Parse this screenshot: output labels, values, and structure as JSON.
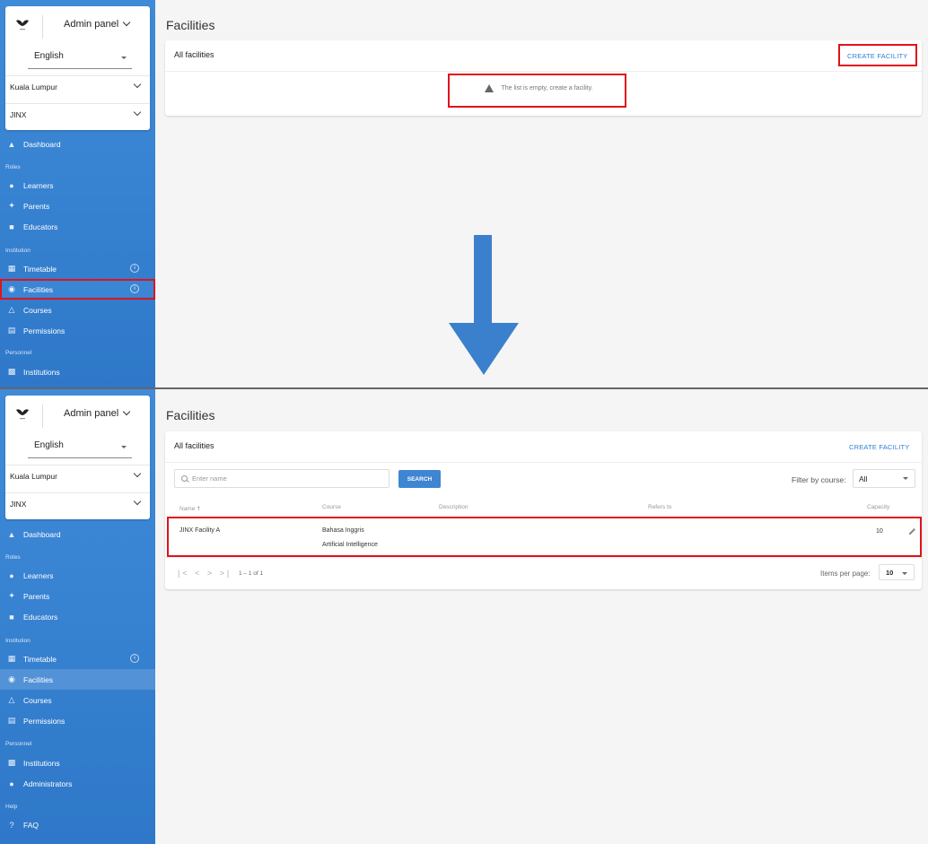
{
  "brand": {
    "logo_icon": "bird-logo-icon",
    "logo_text": "JINX"
  },
  "sidebar": {
    "panel_label": "Admin panel",
    "language": "English",
    "location": "Kuala Lumpur",
    "institution": "JINX",
    "top_nav": {
      "dashboard": "Dashboard",
      "roles": "Roles",
      "learners": "Learners",
      "parents": "Parents",
      "educators": "Educators",
      "institution": "Institution",
      "timetable": "Timetable",
      "facilities": "Facilities",
      "courses": "Courses",
      "permissions": "Permissions",
      "personnel": "Personnel",
      "institutions": "Institutions"
    },
    "bottom_nav_extra": {
      "administrators": "Administrators",
      "help": "Help",
      "faq": "FAQ"
    },
    "info_glyph": "i"
  },
  "before": {
    "heading": "Facilities",
    "card_title": "All facilities",
    "create_label": "CREATE FACILITY",
    "empty_message": "The list is empty, create a facility."
  },
  "after": {
    "heading": "Facilities",
    "card_title": "All facilities",
    "create_label": "CREATE FACILITY",
    "search_placeholder": "Enter name",
    "search_button": "SEARCH",
    "filter_label": "Filter by course:",
    "filter_value": "All",
    "columns": {
      "name": "Name",
      "sort_arrow": "↑",
      "course": "Course",
      "description": "Description",
      "refers_to": "Refers to",
      "capacity": "Capacity"
    },
    "rows": [
      {
        "name": "JINX Facility A",
        "course_1": "Bahasa Inggris",
        "course_2": "Artificial Intelligence",
        "description": "",
        "refers_to": "",
        "capacity": "10"
      }
    ],
    "pagination": {
      "controls": "|< < > >|",
      "range": "1 – 1 of 1",
      "items_per_page_label": "Items per page:",
      "items_per_page_value": "10"
    }
  },
  "colors": {
    "sidebar": "#3a85d4",
    "accent": "#2c7fd5",
    "highlight": "#e0121b",
    "arrow": "#3b80cc"
  }
}
